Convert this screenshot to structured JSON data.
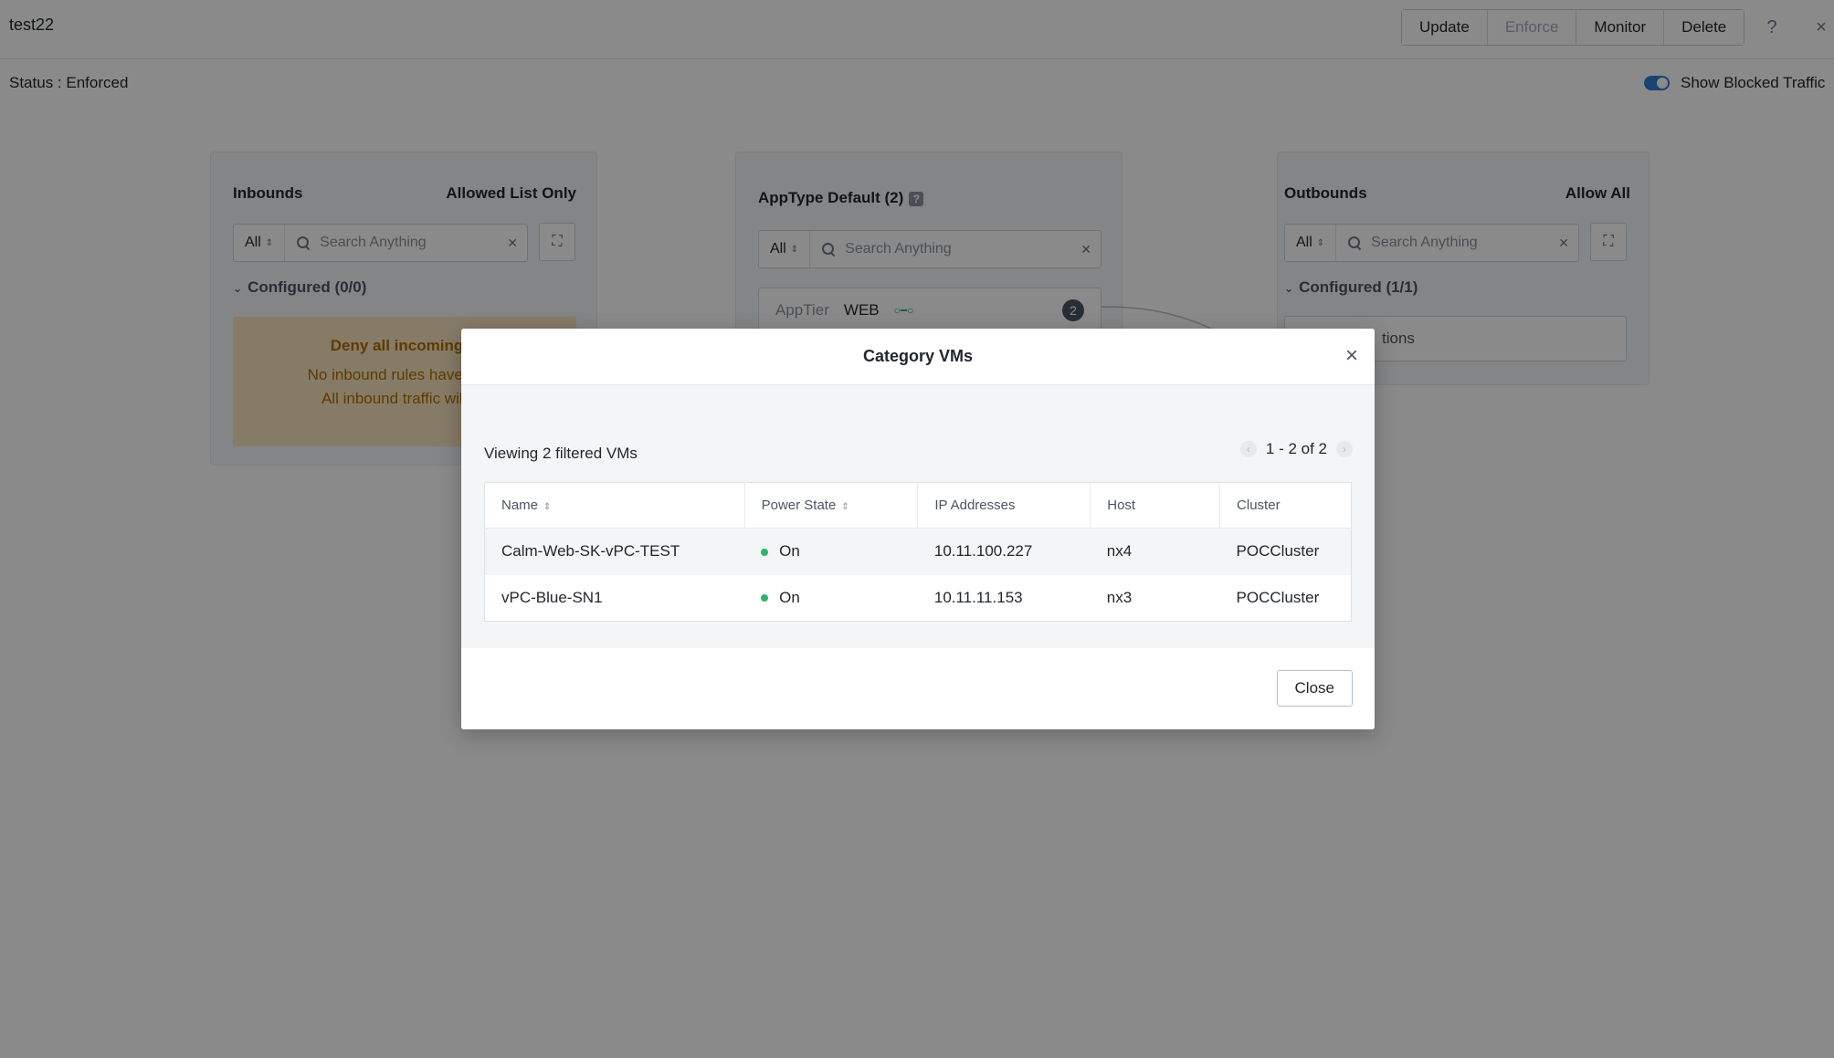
{
  "header": {
    "title": "test22",
    "actions": [
      "Update",
      "Enforce",
      "Monitor",
      "Delete"
    ],
    "help_icon": "?",
    "close_icon": "×"
  },
  "status": {
    "text": "Status : Enforced"
  },
  "toggle": {
    "label": "Show Blocked Traffic",
    "on": true
  },
  "inbound": {
    "title": "Inbounds",
    "mode": "Allowed List Only",
    "search_scope": "All",
    "search_placeholder": "Search Anything",
    "section": "Configured (0/0)",
    "deny_title": "Deny all incoming tr",
    "deny_line1": "No inbound rules have been",
    "deny_line2": "All inbound traffic will be"
  },
  "apptype": {
    "title": "AppType Default (2)",
    "help": "?",
    "search_scope": "All",
    "search_placeholder": "Search Anything",
    "tier_key": "AppTier",
    "tier_value": "WEB",
    "tier_count": "2"
  },
  "outbound": {
    "title": "Outbounds",
    "mode": "Allow All",
    "search_scope": "All",
    "search_placeholder": "Search Anything",
    "section": "Configured (1/1)",
    "item": "tions"
  },
  "modal": {
    "title": "Category VMs",
    "viewing": "Viewing 2 filtered VMs",
    "pager": "1 - 2 of 2",
    "columns": [
      "Name",
      "Power State",
      "IP Addresses",
      "Host",
      "Cluster"
    ],
    "rows": [
      {
        "name": "Calm-Web-SK-vPC-TEST",
        "power": "On",
        "ip": "10.11.100.227",
        "host": "nx4",
        "cluster": "POCCluster"
      },
      {
        "name": "vPC-Blue-SN1",
        "power": "On",
        "ip": "10.11.11.153",
        "host": "nx3",
        "cluster": "POCCluster"
      }
    ],
    "close_label": "Close"
  },
  "colors": {
    "accent": "#2d7dd2",
    "status_on": "#2fb36b",
    "warning_text": "#b06c00",
    "warning_bg": "#f8e3bf"
  }
}
